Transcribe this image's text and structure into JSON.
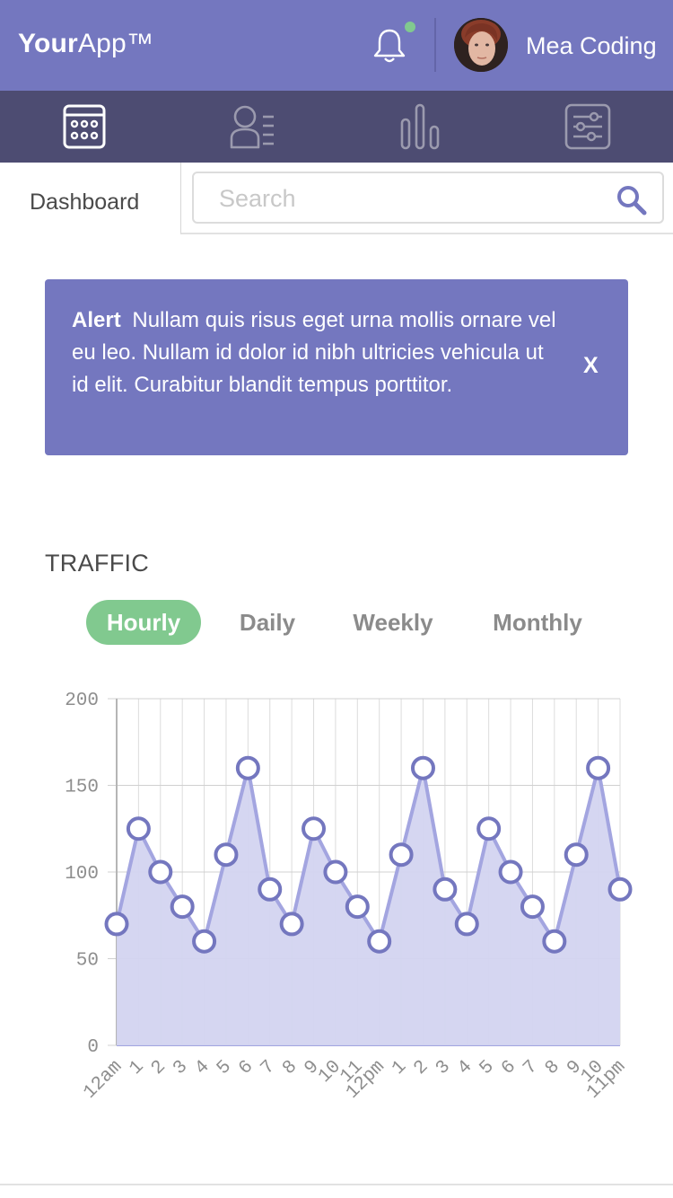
{
  "header": {
    "logo_bold": "Your",
    "logo_light": "App™",
    "user_name": "Mea Coding",
    "notification_dot_color": "#81c98f",
    "background": "#7477bf"
  },
  "nav": {
    "items": [
      {
        "icon": "calendar-icon",
        "active": true
      },
      {
        "icon": "members-icon",
        "active": false
      },
      {
        "icon": "bar-chart-icon",
        "active": false
      },
      {
        "icon": "settings-sliders-icon",
        "active": false
      }
    ],
    "background": "#4d4c72"
  },
  "subheader": {
    "page_label": "Dashboard",
    "search_placeholder": "Search"
  },
  "alert": {
    "title": "Alert",
    "message": "Nullam quis risus eget urna mollis ornare vel eu leo. Nullam id dolor id nibh ultricies vehicula ut id elit. Curabitur blandit tempus porttitor.",
    "close_label": "X"
  },
  "traffic": {
    "title": "TRAFFIC",
    "tabs": [
      "Hourly",
      "Daily",
      "Weekly",
      "Monthly"
    ],
    "active_tab": "Hourly"
  },
  "chart_data": {
    "type": "area",
    "categories": [
      "12am",
      "1",
      "2",
      "3",
      "4",
      "5",
      "6",
      "7",
      "8",
      "9",
      "10",
      "11",
      "12pm",
      "1",
      "2",
      "3",
      "4",
      "5",
      "6",
      "7",
      "8",
      "9",
      "10",
      "11pm"
    ],
    "values": [
      70,
      125,
      100,
      80,
      60,
      110,
      160,
      90,
      70,
      125,
      100,
      80,
      60,
      110,
      160,
      90,
      70,
      125,
      100,
      80,
      60,
      110,
      160,
      90
    ],
    "ylim": [
      0,
      200
    ],
    "yticks": [
      0,
      50,
      100,
      150,
      200
    ],
    "grid": true,
    "line_color": "#a3a5e0",
    "fill_color": "#d3d4f0",
    "point_stroke": "#7477bf"
  }
}
